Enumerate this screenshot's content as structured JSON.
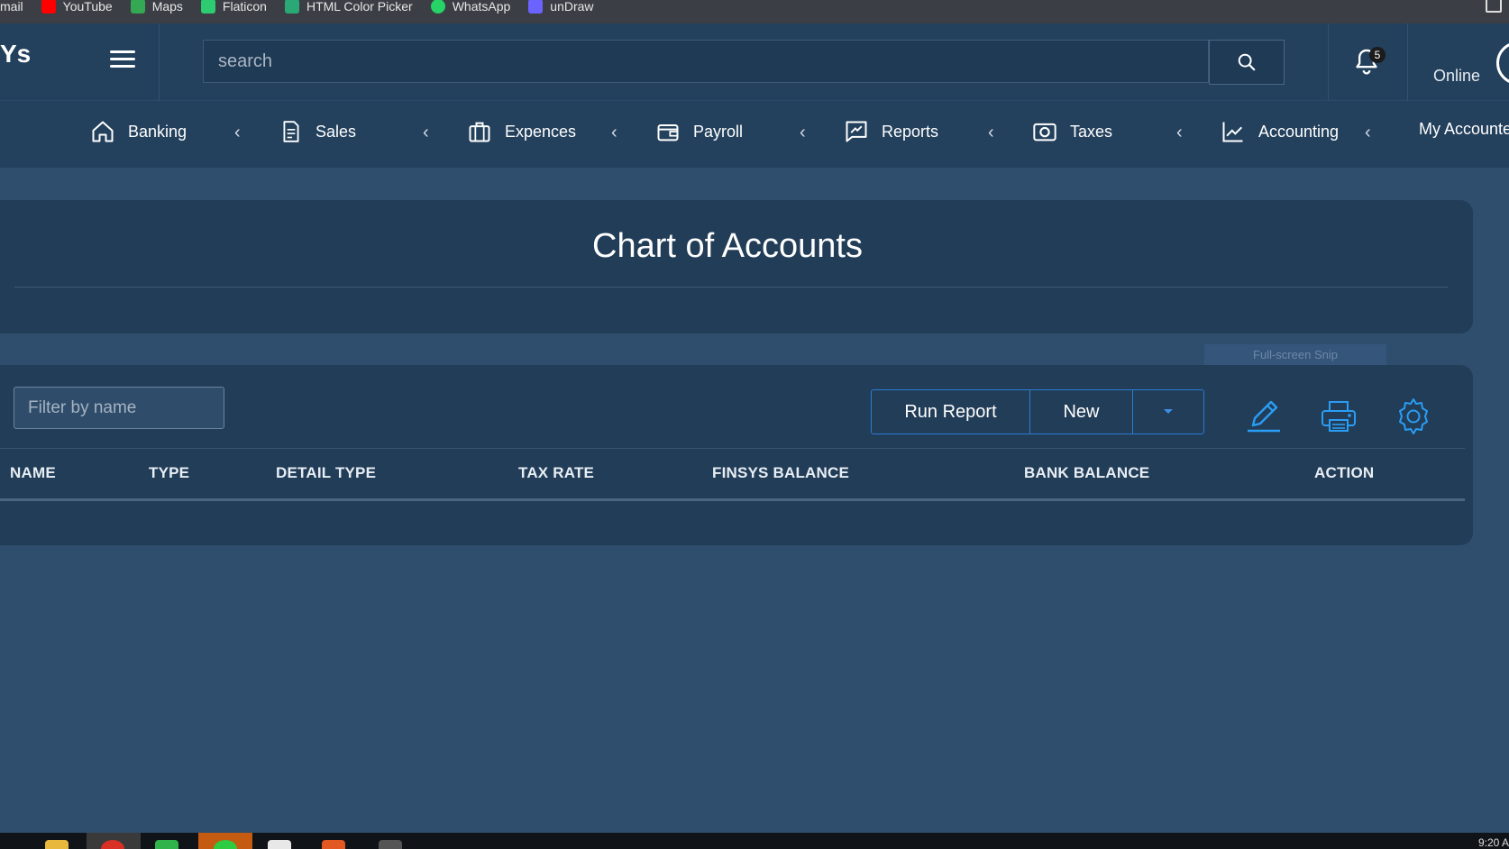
{
  "bookmarks": [
    {
      "label": "mail",
      "color": "#cccccc"
    },
    {
      "label": "YouTube",
      "color": "#ff0000"
    },
    {
      "label": "Maps",
      "color": "#34a853"
    },
    {
      "label": "Flaticon",
      "color": "#2ecc71"
    },
    {
      "label": "HTML Color Picker",
      "color": "#2aa876"
    },
    {
      "label": "WhatsApp",
      "color": "#25d366"
    },
    {
      "label": "unDraw",
      "color": "#6c63ff"
    }
  ],
  "header": {
    "brand": "Ys",
    "search_placeholder": "search",
    "notification_count": "5",
    "status": "Online"
  },
  "nav": [
    {
      "label": "Banking",
      "icon": "home-icon"
    },
    {
      "label": "Sales",
      "icon": "document-icon"
    },
    {
      "label": "Expences",
      "icon": "briefcase-icon"
    },
    {
      "label": "Payroll",
      "icon": "wallet-icon"
    },
    {
      "label": "Reports",
      "icon": "chart-edit-icon"
    },
    {
      "label": "Taxes",
      "icon": "camera-icon"
    },
    {
      "label": "Accounting",
      "icon": "line-chart-icon"
    },
    {
      "label": "My Accountent",
      "icon": ""
    }
  ],
  "chevron": "‹",
  "page": {
    "title": "Chart of Accounts",
    "snip_label": "Full-screen Snip",
    "filter_placeholder": "Filter by name",
    "run_report_label": "Run Report",
    "new_label": "New"
  },
  "table": {
    "columns": [
      "NAME",
      "TYPE",
      "DETAIL TYPE",
      "TAX RATE",
      "FINSYS BALANCE",
      "BANK BALANCE",
      "ACTION"
    ],
    "rows": []
  },
  "taskbar": {
    "clock": "9:20 A"
  },
  "colors": {
    "accent": "#2b7bd1",
    "background": "#2f4d6c",
    "panel": "#223d58"
  }
}
